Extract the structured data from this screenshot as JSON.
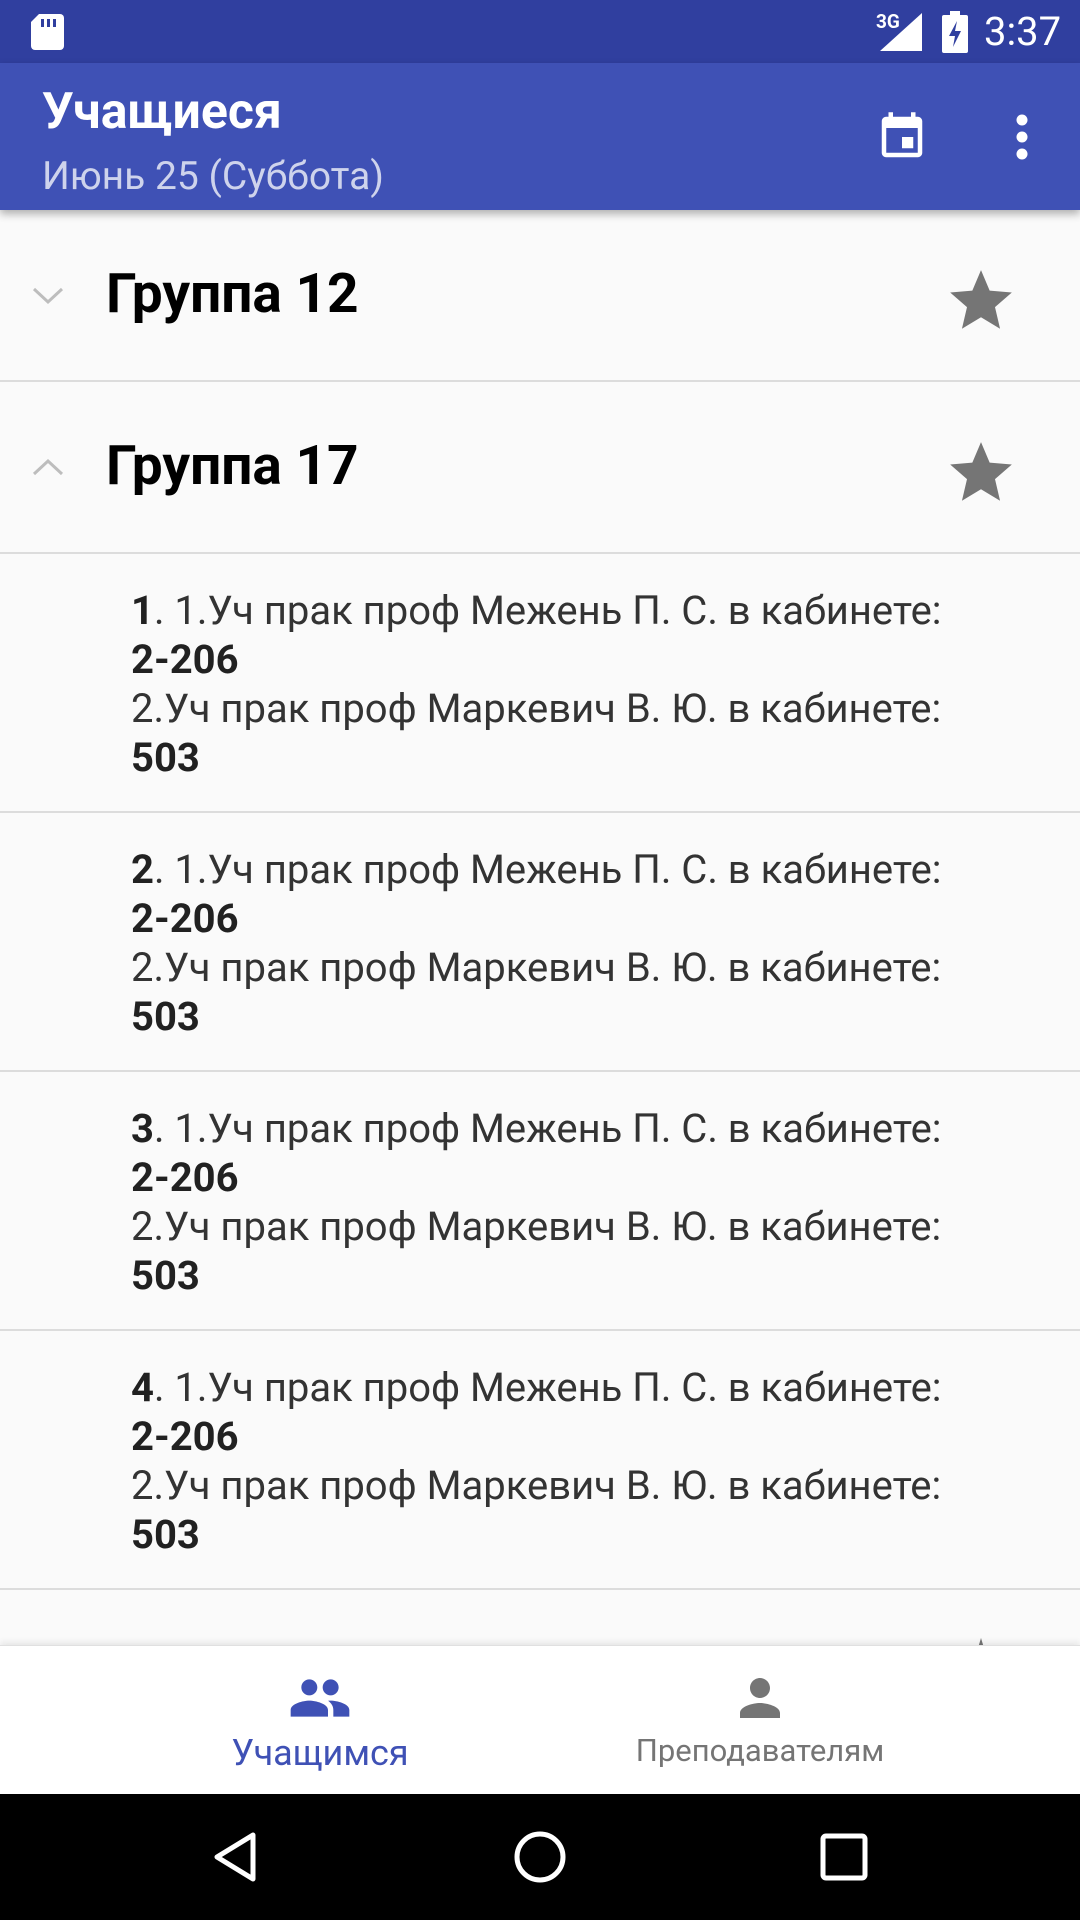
{
  "status_bar": {
    "network": "3G",
    "time": "3:37"
  },
  "app_bar": {
    "title": "Учащиеся",
    "subtitle": "Июнь 25 (Суббота)",
    "color": "#3f51b5"
  },
  "groups": [
    {
      "name": "Группа 12",
      "expanded": false
    },
    {
      "name": "Группа 17",
      "expanded": true
    }
  ],
  "lessons": [
    {
      "number": "1",
      "line1": ". 1.Уч прак проф Межень П. С. в кабинете: ",
      "room1": "2-206",
      "line2": "2.Уч прак проф Маркевич В. Ю. в кабинете: ",
      "room2": "503"
    },
    {
      "number": "2",
      "line1": ". 1.Уч прак проф Межень П. С. в кабинете: ",
      "room1": "2-206",
      "line2": "2.Уч прак проф Маркевич В. Ю. в кабинете: ",
      "room2": "503"
    },
    {
      "number": "3",
      "line1": ". 1.Уч прак проф Межень П. С. в кабинете: ",
      "room1": "2-206",
      "line2": "2.Уч прак проф Маркевич В. Ю. в кабинете: ",
      "room2": "503"
    },
    {
      "number": "4",
      "line1": ". 1.Уч прак проф Межень П. С. в кабинете: ",
      "room1": "2-206",
      "line2": "2.Уч прак проф Маркевич В. Ю. в кабинете: ",
      "room2": "503"
    }
  ],
  "bottom_nav": {
    "students_label": "Учащимся",
    "teachers_label": "Преподавателям",
    "active": "students"
  },
  "icons": {
    "sd_card": "sd-card-icon",
    "signal": "signal-icon",
    "battery": "battery-charging-icon",
    "calendar": "calendar-icon",
    "more": "more-vert-icon",
    "star": "star-icon",
    "chevron_down": "chevron-down-icon",
    "chevron_up": "chevron-up-icon",
    "group": "group-icon",
    "person": "person-icon",
    "back": "back-icon",
    "home": "home-icon",
    "recents": "recents-icon"
  }
}
